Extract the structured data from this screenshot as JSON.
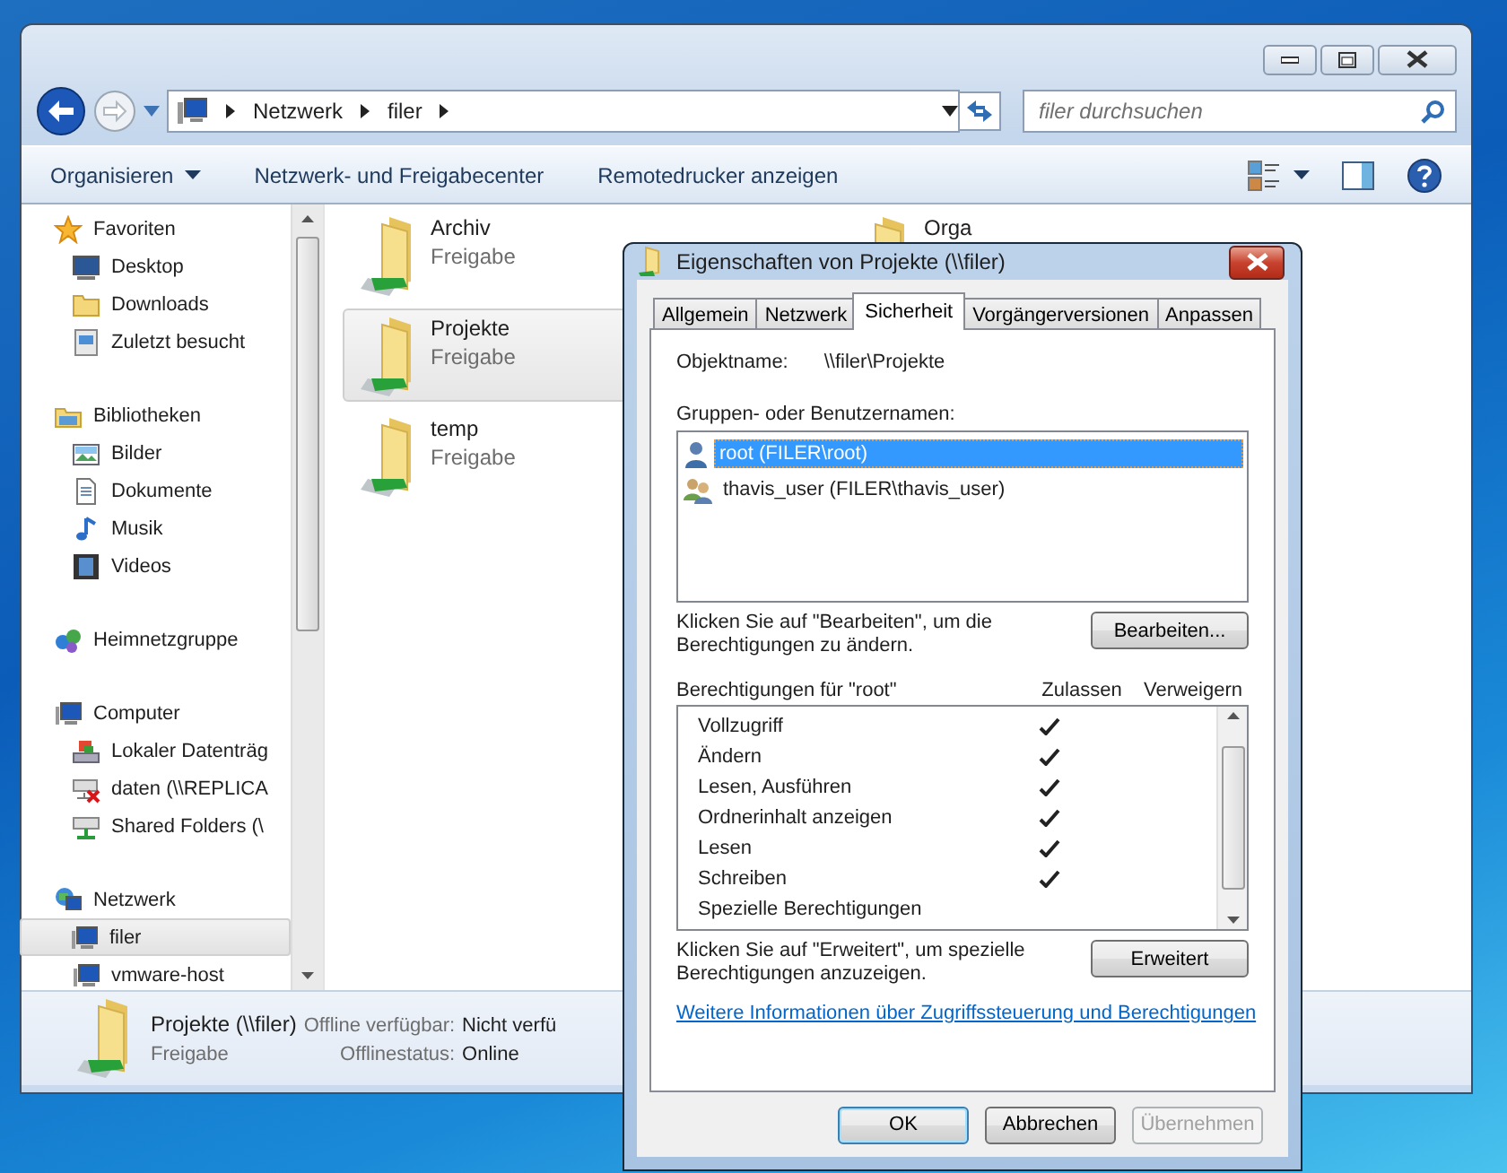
{
  "explorer": {
    "breadcrumb": [
      "Netzwerk",
      "filer"
    ],
    "search": {
      "placeholder": "filer durchsuchen"
    },
    "toolbar": [
      {
        "label": "Organisieren",
        "kind": "menu"
      },
      {
        "label": "Netzwerk- und Freigabecenter",
        "kind": "button"
      },
      {
        "label": "Remotedrucker anzeigen",
        "kind": "button"
      }
    ],
    "nav": [
      {
        "label": "Favoriten",
        "items": [
          {
            "label": "Desktop",
            "selected": false
          },
          {
            "label": "Downloads",
            "selected": false
          },
          {
            "label": "Zuletzt besucht",
            "selected": false
          }
        ]
      },
      {
        "label": "Bibliotheken",
        "items": [
          {
            "label": "Bilder",
            "selected": false
          },
          {
            "label": "Dokumente",
            "selected": false
          },
          {
            "label": "Musik",
            "selected": false
          },
          {
            "label": "Videos",
            "selected": false
          }
        ]
      },
      {
        "label": "Heimnetzgruppe"
      },
      {
        "label": "Computer",
        "items": [
          {
            "label": "Lokaler Datenträg",
            "selected": false
          },
          {
            "label": "daten (\\\\REPLICA",
            "selected": false
          },
          {
            "label": "Shared Folders (\\",
            "selected": false
          }
        ]
      },
      {
        "label": "Netzwerk",
        "items": [
          {
            "label": "filer",
            "selected": true
          },
          {
            "label": "vmware-host",
            "selected": false
          }
        ]
      }
    ],
    "shares": [
      {
        "name": "Archiv",
        "type": "Freigabe",
        "selected": false
      },
      {
        "name": "Projekte",
        "type": "Freigabe",
        "selected": true
      },
      {
        "name": "temp",
        "type": "Freigabe",
        "selected": false
      },
      {
        "name": "Orga",
        "selected": false
      }
    ],
    "details": {
      "name": "Projekte (\\\\filer)",
      "type": "Freigabe",
      "fields": [
        {
          "label": "Offline verfügbar:",
          "value": "Nicht verfü"
        },
        {
          "label": "Offlinestatus:",
          "value": "Online"
        }
      ]
    }
  },
  "dialog": {
    "title": "Eigenschaften von Projekte (\\\\filer)",
    "tabs": [
      {
        "label": "Allgemein",
        "selected": false
      },
      {
        "label": "Netzwerk",
        "selected": false
      },
      {
        "label": "Sicherheit",
        "selected": true
      },
      {
        "label": "Vorgängerversionen",
        "selected": false
      },
      {
        "label": "Anpassen",
        "selected": false
      }
    ],
    "object_label": "Objektname:",
    "object_value": "\\\\filer\\Projekte",
    "users_label": "Gruppen- oder Benutzernamen:",
    "users": [
      {
        "name": "root (FILER\\root)",
        "kind": "user",
        "selected": true
      },
      {
        "name": "thavis_user (FILER\\thavis_user)",
        "kind": "group",
        "selected": false
      }
    ],
    "edit_hint": "Klicken Sie auf \"Bearbeiten\", um die Berechtigungen zu ändern.",
    "edit_button": "Bearbeiten...",
    "permissions_label": "Berechtigungen für \"root\"",
    "permission_columns": [
      "Zulassen",
      "Verweigern"
    ],
    "permissions": [
      {
        "name": "Vollzugriff",
        "allow": true,
        "deny": false
      },
      {
        "name": "Ändern",
        "allow": true,
        "deny": false
      },
      {
        "name": "Lesen, Ausführen",
        "allow": true,
        "deny": false
      },
      {
        "name": "Ordnerinhalt anzeigen",
        "allow": true,
        "deny": false
      },
      {
        "name": "Lesen",
        "allow": true,
        "deny": false
      },
      {
        "name": "Schreiben",
        "allow": true,
        "deny": false
      },
      {
        "name": "Spezielle Berechtigungen",
        "allow": false,
        "deny": false
      }
    ],
    "advanced_hint": "Klicken Sie auf \"Erweitert\", um spezielle Berechtigungen anzuzeigen.",
    "advanced_button": "Erweitert",
    "link": "Weitere Informationen über Zugriffssteuerung und Berechtigungen",
    "buttons": [
      {
        "label": "OK",
        "kind": "default",
        "disabled": false
      },
      {
        "label": "Abbrechen",
        "kind": "normal",
        "disabled": false
      },
      {
        "label": "Übernehmen",
        "kind": "normal",
        "disabled": true
      }
    ]
  }
}
